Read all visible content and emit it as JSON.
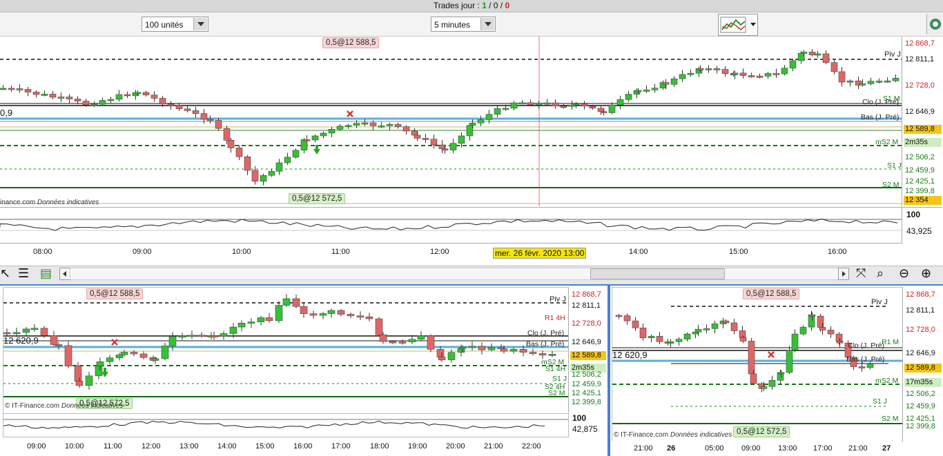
{
  "header": {
    "trades_label": "Trades jour : ",
    "trades_a": "1",
    "sep1": " / ",
    "trades_b": "0",
    "sep2": " / ",
    "trades_c": "0"
  },
  "toolbar": {
    "quantity": "100 unités",
    "interval": "5 minutes"
  },
  "main": {
    "order_sell": "0,5@12 588,5",
    "order_buy": "0,5@12 572,5",
    "left_price": "0,9",
    "credit": "inance.com",
    "credit_note": "Données indicatives",
    "price_labels": [
      {
        "text": "12 868,7",
        "color": "#cc2222"
      },
      {
        "text": "12 811,1",
        "color": "#111111"
      },
      {
        "text": "12 728,0",
        "color": "#cc2222"
      },
      {
        "text": "12 646,9",
        "color": "#111111"
      },
      {
        "text": "12 589,8",
        "color": "#111111",
        "bg": "#f5c518"
      },
      {
        "text": "2m35s",
        "color": "#111111",
        "bg": "#cdeec0"
      },
      {
        "text": "12 506,2",
        "color": "#1a7a1a"
      },
      {
        "text": "12 459,9",
        "color": "#1a7a1a"
      },
      {
        "text": "12 425,1",
        "color": "#1a7a1a"
      },
      {
        "text": "12 399,8",
        "color": "#1a7a1a"
      },
      {
        "text": "12 354",
        "color": "#111111",
        "bg": "#f5c518"
      }
    ],
    "level_names": [
      "Piv J",
      "S1 M",
      "Clo (J. Pré)",
      "Bas (J. Pré)",
      "mS2 M",
      "S1 J",
      "S2 M"
    ],
    "osc_top": "100",
    "osc_val": "43,925",
    "time_labels": [
      "08:00",
      "09:00",
      "10:00",
      "11:00",
      "12:00",
      "13:00",
      "14:00",
      "15:00",
      "16:00"
    ],
    "cursor_date": "mer. 26 févr. 2020 13:00"
  },
  "bottom_left": {
    "order_sell": "0,5@12 588,5",
    "order_buy": "0,5@12 572,5",
    "left_price": "12 620,9",
    "credit": "© IT-Finance.com",
    "credit_note": "Données indicatives",
    "price_labels": [
      {
        "text": "12 868,7",
        "color": "#cc2222"
      },
      {
        "text": "12 811,1",
        "color": "#111111"
      },
      {
        "text": "12 728,0",
        "color": "#cc2222"
      },
      {
        "text": "12 646,9",
        "color": "#111111"
      },
      {
        "text": "12 589,8",
        "color": "#111111",
        "bg": "#f5c518"
      },
      {
        "text": "2m35s",
        "color": "#111111",
        "bg": "#cdeec0"
      },
      {
        "text": "12 506,2",
        "color": "#1a7a1a"
      },
      {
        "text": "12 459,9",
        "color": "#1a7a1a"
      },
      {
        "text": "12 425,1",
        "color": "#1a7a1a"
      },
      {
        "text": "12 399,8",
        "color": "#1a7a1a"
      }
    ],
    "level_names": [
      "Piv J",
      "R1 4H",
      "Clo (J. Pré)",
      "Bas (J. Pré)",
      "mS2 M",
      "S1 4H",
      "S1 J",
      "S2 4H",
      "S2 M"
    ],
    "osc_top": "100",
    "osc_val": "42,875",
    "time_labels": [
      "09:00",
      "10:00",
      "11:00",
      "12:00",
      "13:00",
      "14:00",
      "15:00",
      "16:00",
      "17:00",
      "18:00",
      "19:00",
      "20:00",
      "21:00",
      "22:00"
    ]
  },
  "bottom_right": {
    "order_sell": "0,5@12 588,5",
    "order_buy": "0,5@12 572,5",
    "left_price": "12 620,9",
    "credit": "© IT-Finance.com",
    "credit_note": "Données indicatives",
    "price_labels": [
      {
        "text": "12 868,7",
        "color": "#cc2222"
      },
      {
        "text": "12 811,1",
        "color": "#111111"
      },
      {
        "text": "12 728,0",
        "color": "#cc2222"
      },
      {
        "text": "12 646,9",
        "color": "#111111"
      },
      {
        "text": "12 589,8",
        "color": "#111111",
        "bg": "#f5c518"
      },
      {
        "text": "17m35s",
        "color": "#111111",
        "bg": "#cdeec0"
      },
      {
        "text": "12 506,2",
        "color": "#1a7a1a"
      },
      {
        "text": "12 459,9",
        "color": "#1a7a1a"
      },
      {
        "text": "12 425,1",
        "color": "#1a7a1a"
      },
      {
        "text": "12 399,8",
        "color": "#1a7a1a"
      }
    ],
    "level_names": [
      "Piv J",
      "R1 M",
      "Clo (J. Pré)",
      "Bas (J. Pré)",
      "mS2 M",
      "S1 J",
      "S2 M"
    ],
    "time_labels": [
      "21:00",
      "26",
      "05:00",
      "09:00",
      "13:00",
      "17:00",
      "21:00",
      "27"
    ]
  },
  "icons": {
    "window_tools": [
      "window-icon",
      "close-circle-icon",
      "red-arrow-icon",
      "green-arrow-icon"
    ],
    "scroll_tools": [
      "cursor-tool-icon",
      "list-icon",
      "indicator-icon",
      "fit-icon",
      "zoom-fit-icon",
      "zoom-out-icon",
      "zoom-in-icon"
    ]
  },
  "colors": {
    "up": "#2fc12f",
    "down": "#e06a6a",
    "support": "#0a7a0a",
    "blue_line": "#5aaedf"
  }
}
